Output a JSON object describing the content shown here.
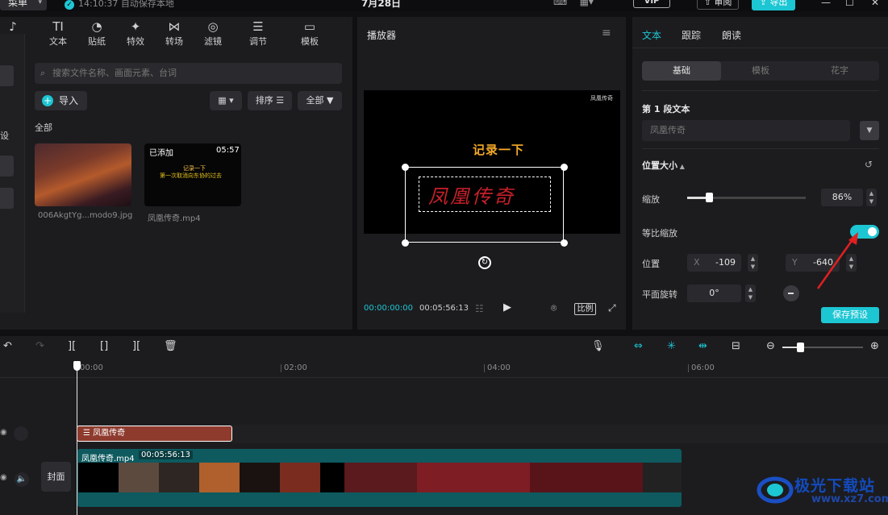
{
  "topbar": {
    "menu_label": "菜单",
    "save_status": "14:10:37 自动保存本地",
    "project_title": "7月28日",
    "review_label": "审阅",
    "export_label": "导出"
  },
  "tools": [
    {
      "label": "音频",
      "icon": "audio-icon",
      "glyph": "♪"
    },
    {
      "label": "文本",
      "icon": "text-icon",
      "glyph": "TI"
    },
    {
      "label": "贴纸",
      "icon": "sticker-icon",
      "glyph": "◔"
    },
    {
      "label": "特效",
      "icon": "effects-icon",
      "glyph": "✦"
    },
    {
      "label": "转场",
      "icon": "transition-icon",
      "glyph": "⋈"
    },
    {
      "label": "滤镜",
      "icon": "filter-icon",
      "glyph": "◎"
    },
    {
      "label": "调节",
      "icon": "adjust-icon",
      "glyph": "☰"
    },
    {
      "label": "模板",
      "icon": "template-icon",
      "glyph": "▭"
    }
  ],
  "sidebar": {
    "partial_label": "设"
  },
  "media": {
    "search_placeholder": "搜索文件名称、画面元素、台词",
    "import_label": "导入",
    "sort_label": "排序",
    "filter_label": "全部",
    "section_label": "全部",
    "items": [
      {
        "name": "006AkgtYg...modo9.jpg"
      },
      {
        "name": "凤凰传奇.mp4",
        "badge": "已添加",
        "duration": "05:57"
      }
    ],
    "thumb2_title": "记录一下",
    "thumb2_sub": "第一次取消向东协的过去"
  },
  "player": {
    "title": "播放器",
    "watermark": "凤凰传奇",
    "video_title": "记录一下",
    "signature_text": "凤凰传奇",
    "current_time": "00:00:00:00",
    "total_time": "00:05:56:13",
    "ratio_label": "比例"
  },
  "inspector": {
    "tabs": [
      "文本",
      "跟踪",
      "朗读"
    ],
    "segments": [
      "基础",
      "模板",
      "花字"
    ],
    "section_title": "第 1 段文本",
    "text_value": "凤凰传奇",
    "pos_size_title": "位置大小",
    "scale_label": "缩放",
    "scale_value": "86%",
    "scale_fraction": 0.86,
    "uniform_label": "等比缩放",
    "uniform_on": true,
    "position_label": "位置",
    "x_tag": "X",
    "x_value": "-109",
    "y_tag": "Y",
    "y_value": "-640",
    "rotate_label": "平面旋转",
    "rotate_value": "0°",
    "save_preset_label": "保存预设"
  },
  "timeline": {
    "ticks": [
      "00:00",
      "02:00",
      "04:00",
      "06:00"
    ],
    "text_clip_label": "凤凰传奇",
    "video_clip_label": "凤凰传奇.mp4",
    "video_clip_time": "00:05:56:13",
    "cover_label": "封面"
  },
  "watermark": {
    "text": "极光下载站",
    "url": "www.xz7.com"
  },
  "colors": {
    "accent": "#1cc6d3",
    "text_clip": "#8e3b2e",
    "video_clip": "#0e5a5f",
    "annotation_arrow": "#e02020"
  }
}
